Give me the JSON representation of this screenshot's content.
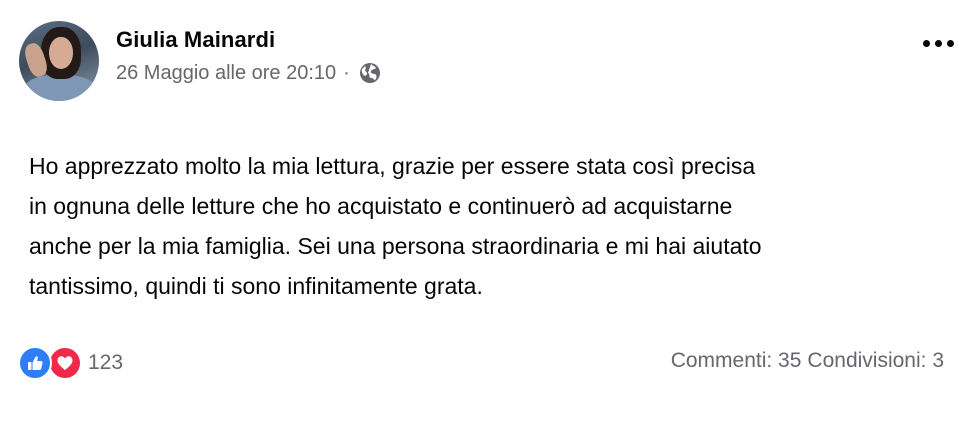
{
  "post": {
    "author": "Giulia Mainardi",
    "timestamp": "26 Maggio alle ore 20:10",
    "separator": "·",
    "privacy_icon": "globe-icon",
    "more_icon": "more-options-icon",
    "text": "Ho apprezzato molto la mia lettura, grazie per essere stata così precisa\nin ognuna delle letture che ho acquistato e continuerò ad acquistarne\nanche per la mia famiglia. Sei una persona straordinaria e mi hai aiutato\ntantissimo, quindi ti sono infinitamente grata."
  },
  "reactions": {
    "icons": [
      "like-icon",
      "love-icon"
    ],
    "count": "123",
    "colors": {
      "like": "#2d7ef7",
      "love": "#f0284a"
    }
  },
  "stats": {
    "comments": "Commenti: 35",
    "shares": "Condivisioni: 3"
  }
}
